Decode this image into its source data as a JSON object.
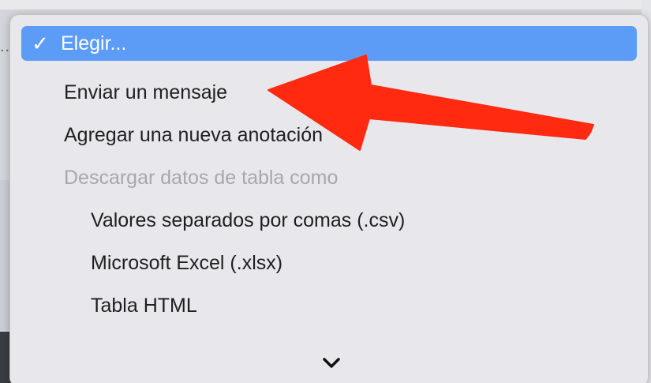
{
  "menu": {
    "items": [
      {
        "label": "Elegir...",
        "selected": true
      },
      {
        "label": "Enviar un mensaje"
      },
      {
        "label": "Agregar una nueva anotación"
      },
      {
        "label": "Descargar datos de tabla como",
        "disabled": true
      },
      {
        "label": "Valores separados por comas (.csv)"
      },
      {
        "label": "Microsoft Excel (.xlsx)"
      },
      {
        "label": "Tabla HTML"
      }
    ],
    "check_icon": "checkmark-icon",
    "more_icon": "chevron-down-icon"
  },
  "background": {
    "ellipsis": "..."
  },
  "colors": {
    "selection": "#5c9cf6",
    "arrow": "#ff2a10",
    "disabled_text": "#a7a8ac"
  }
}
